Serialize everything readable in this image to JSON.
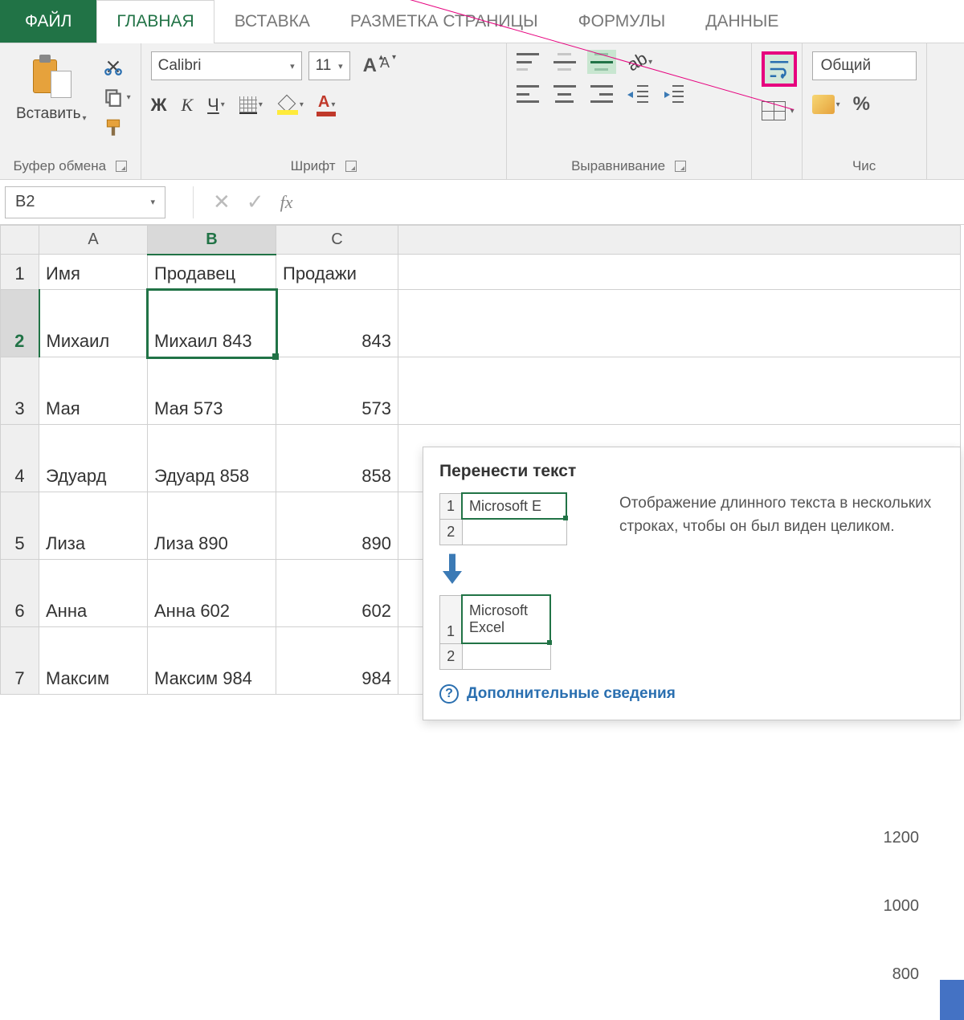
{
  "tabs": {
    "file": "ФАЙЛ",
    "home": "ГЛАВНАЯ",
    "insert": "ВСТАВКА",
    "layout": "РАЗМЕТКА СТРАНИЦЫ",
    "formulas": "ФОРМУЛЫ",
    "data": "ДАННЫЕ"
  },
  "ribbon": {
    "clipboard": {
      "paste": "Вставить",
      "label": "Буфер обмена"
    },
    "font": {
      "name": "Calibri",
      "size": "11",
      "label": "Шрифт",
      "bold": "Ж",
      "italic": "К",
      "underline": "Ч",
      "color_letter": "А"
    },
    "alignment": {
      "label": "Выравнивание"
    },
    "number": {
      "format": "Общий",
      "label": "Чис",
      "percent": "%"
    }
  },
  "formula_bar": {
    "cell_ref": "B2",
    "fx": "fx"
  },
  "grid": {
    "columns": [
      "A",
      "B",
      "C"
    ],
    "headers": {
      "a": "Имя",
      "b": "Продавец",
      "c": "Продажи"
    },
    "rows": [
      {
        "n": "2",
        "a": "Михаил",
        "b": "Михаил 843",
        "c": "843"
      },
      {
        "n": "3",
        "a": "Мая",
        "b": "Мая 573",
        "c": "573"
      },
      {
        "n": "4",
        "a": "Эдуард",
        "b": "Эдуард 858",
        "c": "858"
      },
      {
        "n": "5",
        "a": "Лиза",
        "b": "Лиза 890",
        "c": "890"
      },
      {
        "n": "6",
        "a": "Анна",
        "b": "Анна 602",
        "c": "602"
      },
      {
        "n": "7",
        "a": "Максим",
        "b": "Максим 984",
        "c": "984"
      }
    ]
  },
  "tooltip": {
    "title": "Перенести текст",
    "desc": "Отображение длинного текста в нескольких строках, чтобы он был виден целиком.",
    "more": "Дополнительные сведения",
    "illus": {
      "before": "Microsoft E",
      "after1": "Microsoft",
      "after2": "Excel",
      "r1": "1",
      "r2": "2"
    }
  },
  "axis": {
    "t1": "1200",
    "t2": "1000",
    "t3": "800"
  }
}
